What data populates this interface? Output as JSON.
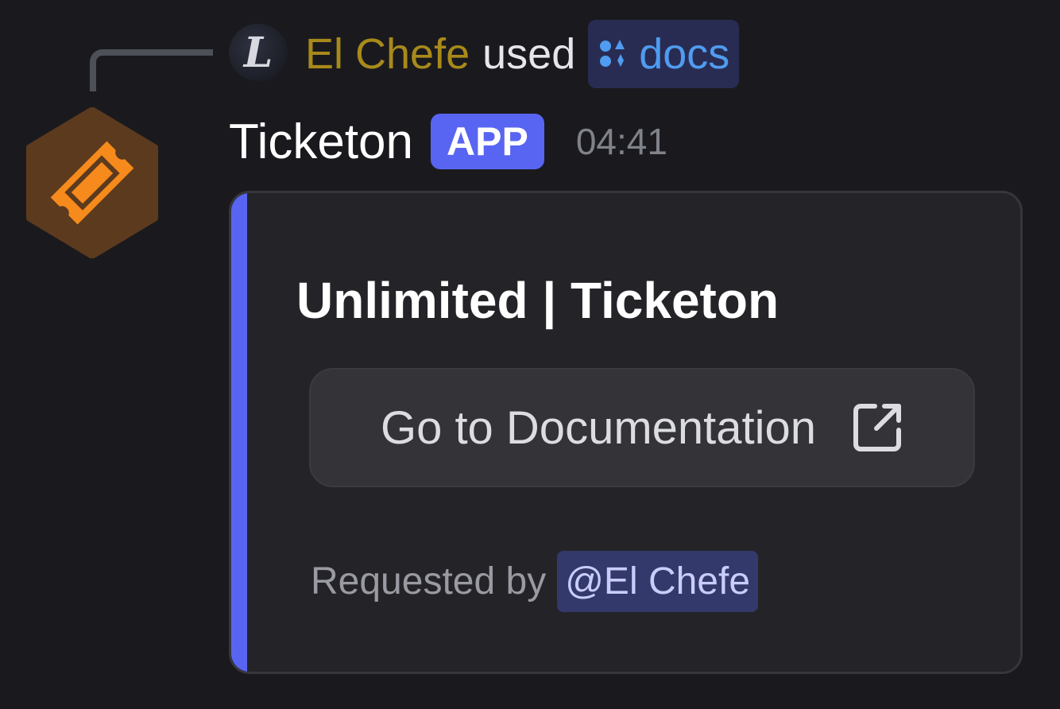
{
  "reply": {
    "avatar_letter": "L",
    "user": "El Chefe",
    "used_label": "used",
    "command": "docs",
    "command_color": "#4f9cf0",
    "user_color": "#a88a1a"
  },
  "message": {
    "bot_name": "Ticketon",
    "badge": "APP",
    "timestamp": "04:41",
    "avatar_icon": "ticket-icon"
  },
  "embed": {
    "accent_color": "#5865f2",
    "title": "Unlimited | Ticketon",
    "button_label": "Go to Documentation",
    "button_icon": "external-link-icon",
    "footer_prefix": "Requested by",
    "footer_mention": "@El Chefe"
  }
}
